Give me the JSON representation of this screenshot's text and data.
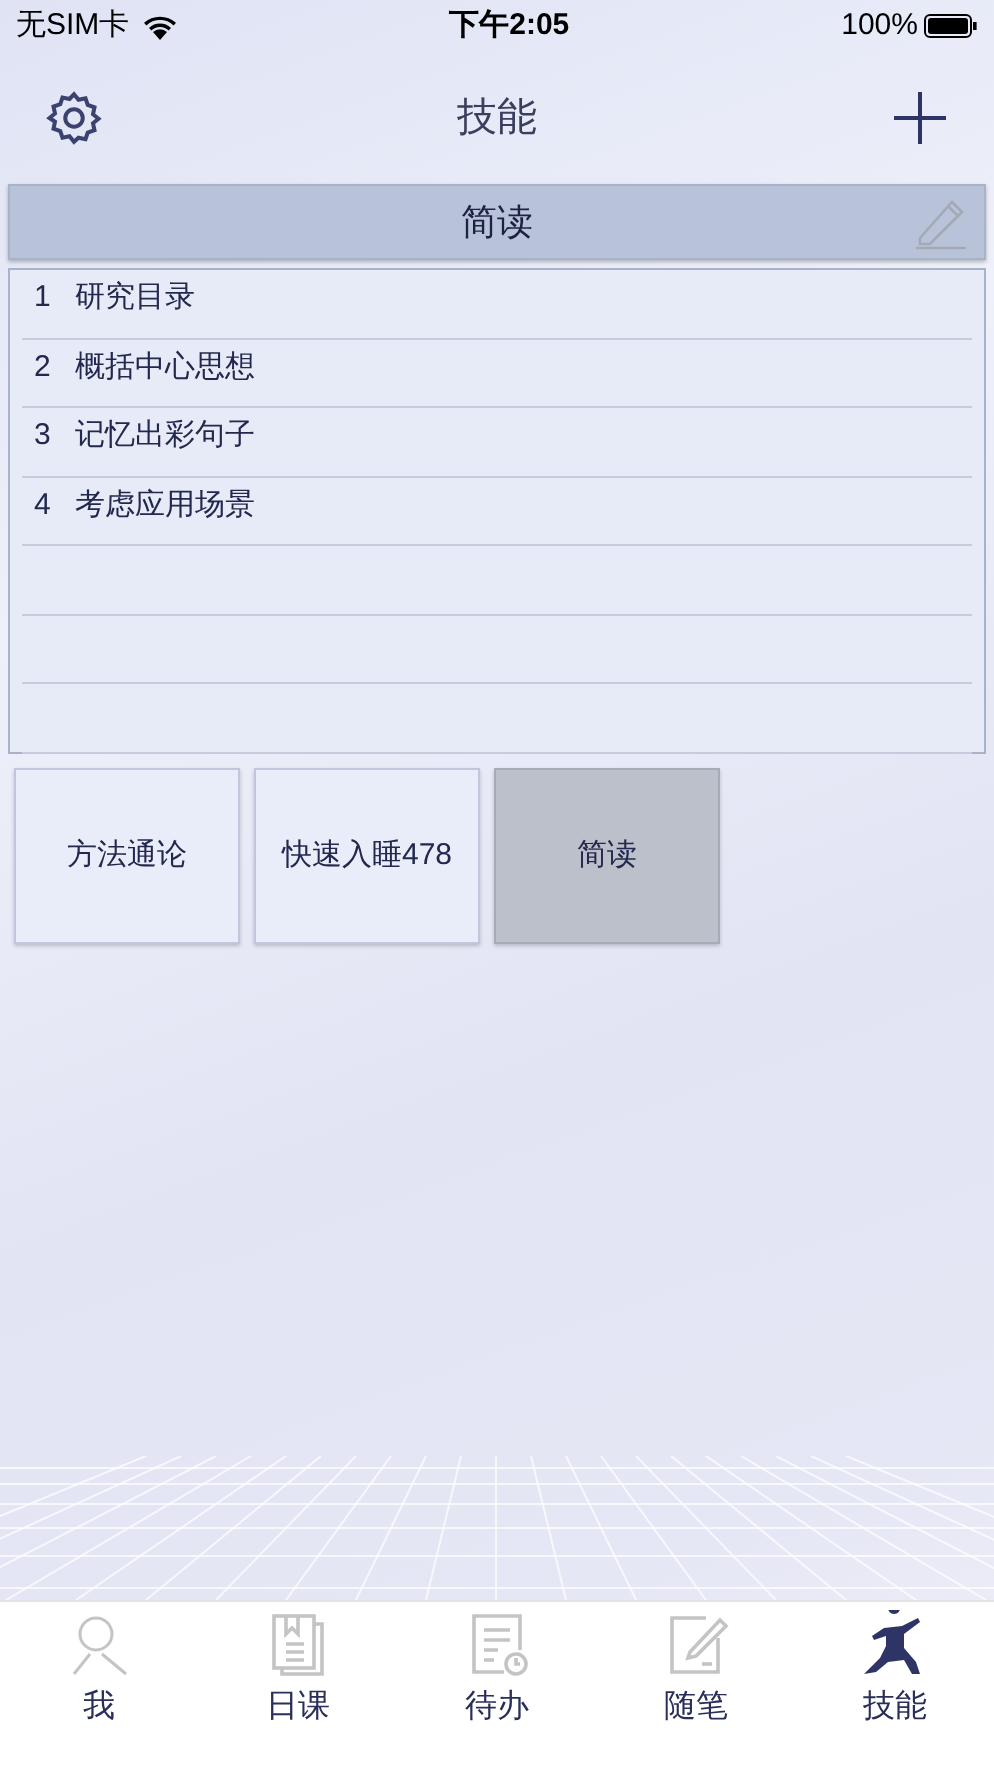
{
  "status_bar": {
    "carrier": "无SIM卡",
    "time": "下午2:05",
    "battery": "100%"
  },
  "nav": {
    "title": "技能"
  },
  "header": {
    "title": "简读"
  },
  "steps": [
    {
      "number": "1",
      "text": "研究目录"
    },
    {
      "number": "2",
      "text": "概括中心思想"
    },
    {
      "number": "3",
      "text": "记忆出彩句子"
    },
    {
      "number": "4",
      "text": "考虑应用场景"
    }
  ],
  "skills": [
    {
      "label": "方法通论",
      "selected": false
    },
    {
      "label": "快速入睡478",
      "selected": false
    },
    {
      "label": "简读",
      "selected": true
    }
  ],
  "tabs": [
    {
      "label": "我",
      "kind": "me",
      "selected": false
    },
    {
      "label": "日课",
      "kind": "lesson",
      "selected": false
    },
    {
      "label": "待办",
      "kind": "todo",
      "selected": false
    },
    {
      "label": "随笔",
      "kind": "note",
      "selected": false
    },
    {
      "label": "技能",
      "kind": "skill",
      "selected": true
    }
  ]
}
